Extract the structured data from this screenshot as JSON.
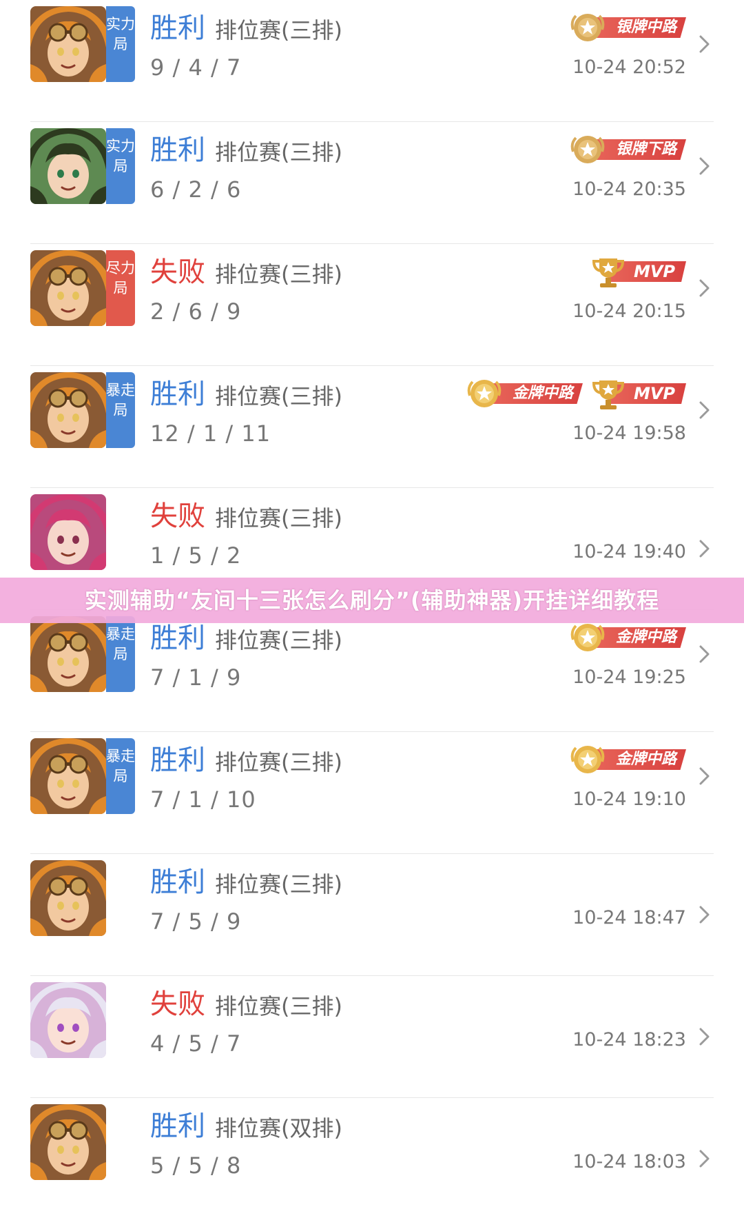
{
  "matches": [
    {
      "hero": "goggle-girl",
      "tag": "实力局",
      "tag_color": "blue",
      "result": "胜利",
      "outcome": "win",
      "mode": "排位赛(三排)",
      "kda": "9 / 4 / 7",
      "time": "10-24 20:52",
      "badges": [
        {
          "kind": "medal",
          "tier": "silver",
          "label": "银牌中路"
        }
      ]
    },
    {
      "hero": "green-hair-hero",
      "tag": "实力局",
      "tag_color": "blue",
      "result": "胜利",
      "outcome": "win",
      "mode": "排位赛(三排)",
      "kda": "6 / 2 / 6",
      "time": "10-24 20:35",
      "badges": [
        {
          "kind": "medal",
          "tier": "silver",
          "label": "银牌下路"
        }
      ]
    },
    {
      "hero": "goggle-girl",
      "tag": "尽力局",
      "tag_color": "red",
      "result": "失败",
      "outcome": "lose",
      "mode": "排位赛(三排)",
      "kda": "2 / 6 / 9",
      "time": "10-24 20:15",
      "badges": [
        {
          "kind": "mvp",
          "label": "MVP"
        }
      ]
    },
    {
      "hero": "goggle-girl",
      "tag": "暴走局",
      "tag_color": "blue",
      "result": "胜利",
      "outcome": "win",
      "mode": "排位赛(三排)",
      "kda": "12 / 1 / 11",
      "time": "10-24 19:58",
      "badges": [
        {
          "kind": "medal",
          "tier": "gold",
          "label": "金牌中路"
        },
        {
          "kind": "mvp",
          "label": "MVP"
        }
      ]
    },
    {
      "hero": "pink-hair-hero",
      "tag": "",
      "tag_color": "",
      "result": "失败",
      "outcome": "lose",
      "mode": "排位赛(三排)",
      "kda": "1 / 5 / 2",
      "time": "10-24 19:40",
      "badges": []
    },
    {
      "hero": "goggle-girl",
      "tag": "暴走局",
      "tag_color": "blue",
      "result": "胜利",
      "outcome": "win",
      "mode": "排位赛(三排)",
      "kda": "7 / 1 / 9",
      "time": "10-24 19:25",
      "badges": [
        {
          "kind": "medal",
          "tier": "gold",
          "label": "金牌中路"
        }
      ]
    },
    {
      "hero": "goggle-girl",
      "tag": "暴走局",
      "tag_color": "blue",
      "result": "胜利",
      "outcome": "win",
      "mode": "排位赛(三排)",
      "kda": "7 / 1 / 10",
      "time": "10-24 19:10",
      "badges": [
        {
          "kind": "medal",
          "tier": "gold",
          "label": "金牌中路"
        }
      ]
    },
    {
      "hero": "goggle-girl",
      "tag": "",
      "tag_color": "",
      "result": "胜利",
      "outcome": "win",
      "mode": "排位赛(三排)",
      "kda": "7 / 5 / 9",
      "time": "10-24 18:47",
      "badges": []
    },
    {
      "hero": "silver-hair-hero",
      "tag": "",
      "tag_color": "",
      "result": "失败",
      "outcome": "lose",
      "mode": "排位赛(三排)",
      "kda": "4 / 5 / 7",
      "time": "10-24 18:23",
      "badges": []
    },
    {
      "hero": "goggle-girl",
      "tag": "",
      "tag_color": "",
      "result": "胜利",
      "outcome": "win",
      "mode": "排位赛(双排)",
      "kda": "5 / 5 / 8",
      "time": "10-24 18:03",
      "badges": []
    }
  ],
  "banner": {
    "text": "实测辅助“友间十三张怎么刷分”(辅助神器)开挂详细教程"
  },
  "colors": {
    "win": "#3d7ed6",
    "lose": "#e0413c",
    "tag_blue": "#4a86d4",
    "tag_red": "#e1594c",
    "banner": "#f2aadc"
  }
}
